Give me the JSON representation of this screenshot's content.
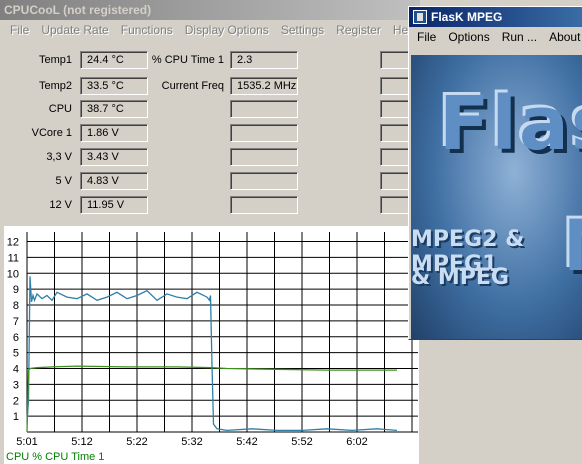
{
  "cpucool": {
    "title": "CPUCooL (not registered)",
    "menu": [
      "File",
      "Update Rate",
      "Functions",
      "Display Options",
      "Settings",
      "Register",
      "Help"
    ],
    "left_readouts": [
      {
        "label": "Temp1",
        "value": "24.4 °C"
      },
      {
        "label": "Temp2",
        "value": "33.5 °C"
      },
      {
        "label": "CPU",
        "value": "38.7 °C"
      },
      {
        "label": "VCore 1",
        "value": "1.86 V"
      },
      {
        "label": "3,3 V",
        "value": "3.43 V"
      },
      {
        "label": "5 V",
        "value": "4.83 V"
      },
      {
        "label": "12 V",
        "value": "11.95 V"
      }
    ],
    "right_readouts": [
      {
        "label": "% CPU Time 1",
        "value": "2.3"
      },
      {
        "label": "Current Freq",
        "value": "1535.2 MHz"
      },
      {
        "label": "",
        "value": ""
      },
      {
        "label": "",
        "value": ""
      },
      {
        "label": "",
        "value": ""
      },
      {
        "label": "",
        "value": ""
      },
      {
        "label": "",
        "value": ""
      }
    ],
    "legend": "CPU % CPU Time 1",
    "colors": {
      "cpu_series": "#2f7fa8",
      "green_series": "#3f8f1f",
      "legend": "#008000",
      "grid": "#000000"
    }
  },
  "chart_data": {
    "type": "line",
    "x_tick_labels": [
      "5:01",
      "5:12",
      "5:22",
      "5:32",
      "5:42",
      "5:52",
      "6:02"
    ],
    "y_ticks": [
      1,
      2,
      3,
      4,
      5,
      6,
      7,
      8,
      9,
      10,
      11,
      12
    ],
    "ylim": [
      0,
      12.6
    ],
    "grid": true,
    "series": [
      {
        "name": "CPU % CPU Time 1",
        "color": "#2f7fa8",
        "x_minutes": [
          0.0,
          0.3,
          0.6,
          0.9,
          1.2,
          1.5,
          2,
          3,
          4,
          5,
          6,
          8,
          10,
          12,
          14,
          16,
          18,
          20,
          22,
          24,
          26,
          28,
          30,
          32,
          34,
          36,
          36.5,
          36.7,
          37,
          37.3,
          38,
          40,
          45,
          50,
          55,
          60,
          65,
          70,
          74
        ],
        "values": [
          0.6,
          2.0,
          9.8,
          8.2,
          8.6,
          8.3,
          8.7,
          8.4,
          8.6,
          8.3,
          8.8,
          8.5,
          8.4,
          8.7,
          8.3,
          8.5,
          8.8,
          8.4,
          8.6,
          8.9,
          8.3,
          8.7,
          8.5,
          8.4,
          8.8,
          8.5,
          8.3,
          8.6,
          4.2,
          0.5,
          0.2,
          0.1,
          0.2,
          0.1,
          0.1,
          0.2,
          0.1,
          0.2,
          0.1
        ]
      },
      {
        "name": "",
        "color": "#3f8f1f",
        "x_minutes": [
          0.0,
          0.3,
          0.6,
          2,
          5,
          10,
          20,
          30,
          37,
          40,
          50,
          60,
          74
        ],
        "values": [
          0.0,
          3.9,
          4.0,
          4.05,
          4.1,
          4.15,
          4.1,
          4.1,
          4.05,
          4.0,
          3.95,
          3.9,
          3.9
        ]
      }
    ]
  },
  "flask": {
    "title": "FlasK MPEG",
    "menu": [
      "File",
      "Options",
      "Run ...",
      "About"
    ],
    "logo_text": "Flask",
    "logo_sub1": "MPEG2 & MPEG1",
    "logo_sub2": "& MPEG",
    "logo_m": "M"
  }
}
